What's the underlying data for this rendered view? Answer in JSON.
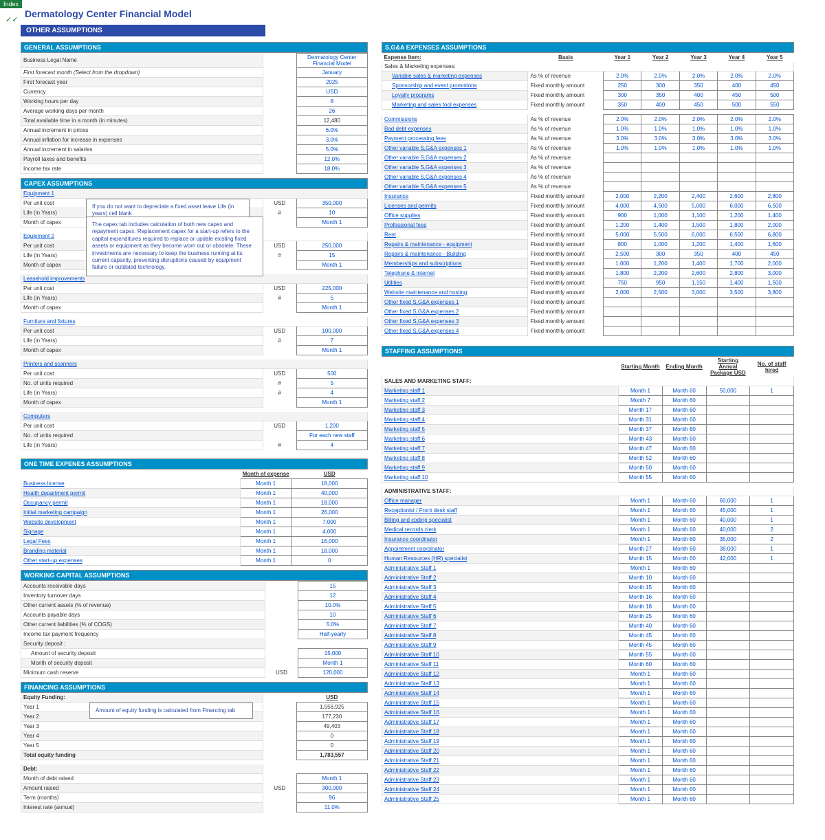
{
  "indexTag": "Index",
  "title": "Dermatology Center Financial Model",
  "sectionBar": "OTHER ASSUMPTIONS",
  "general": {
    "head": "GENERAL ASSUMPTIONS",
    "rows": [
      {
        "l": "Business Legal Name",
        "v": "Dermatology Center Financial Model"
      },
      {
        "l": "First forecast month (Select from the dropdown)",
        "v": "January",
        "i": 1
      },
      {
        "l": "First forecast year",
        "v": "2025"
      },
      {
        "l": "Currency",
        "v": "USD"
      },
      {
        "l": "Working hours per day",
        "v": "8"
      },
      {
        "l": "Average working days per month",
        "v": "26"
      },
      {
        "l": "Total available time in a month (in minutes)",
        "v": "12,480",
        "calc": 1
      },
      {
        "l": "Annual increment in prices",
        "v": "6.0%"
      },
      {
        "l": "Annual inflation for increase in expenses",
        "v": "3.0%"
      },
      {
        "l": "Annual increment in salaries",
        "v": "5.0%"
      },
      {
        "l": "Payroll taxes and benefits",
        "v": "12.0%"
      },
      {
        "l": "Income tax rate",
        "v": "18.0%"
      }
    ]
  },
  "capex": {
    "head": "CAPEX ASSUMPTIONS",
    "note1": "If you do not want to depreciate a fixed asset leave Life (in years) cell blank",
    "note2": "The capex tab includes calculation of both new capex and repayment capex. Replacement capex for a start-up refers to the capital expenditures required to replace or update existing fixed assets or equipment as they become worn out or obsolete. These investments are necessary to keep the business running at its current capacity, preventing disruptions caused by equipment failure or outdated technology.",
    "groups": [
      {
        "name": "Equipment 1",
        "rows": [
          [
            "Per unit cost",
            "USD",
            "350,000"
          ],
          [
            "Life (in Years)",
            "#",
            "10"
          ],
          [
            "Month of capex",
            "",
            "Month 1"
          ]
        ]
      },
      {
        "name": "Equipment 2",
        "rows": [
          [
            "Per unit cost",
            "USD",
            "250,000"
          ],
          [
            "Life (in Years)",
            "#",
            "15"
          ],
          [
            "Month of capex",
            "",
            "Month 1"
          ]
        ]
      },
      {
        "name": "Leasehold improvements",
        "rows": [
          [
            "Per unit cost",
            "USD",
            "225,000"
          ],
          [
            "Life (in Years)",
            "#",
            "5"
          ],
          [
            "Month of capex",
            "",
            "Month 1"
          ]
        ]
      },
      {
        "name": "Furniture and fixtures",
        "rows": [
          [
            "Per unit cost",
            "USD",
            "100,000"
          ],
          [
            "Life (in Years)",
            "#",
            "7"
          ],
          [
            "Month of capex",
            "",
            "Month 1"
          ]
        ]
      },
      {
        "name": "Printers and scanners",
        "rows": [
          [
            "Per unit cost",
            "USD",
            "500"
          ],
          [
            "No. of units required",
            "#",
            "5"
          ],
          [
            "Life (in Years)",
            "#",
            "4"
          ],
          [
            "Month of capex",
            "",
            "Month 1"
          ]
        ]
      },
      {
        "name": "Computers",
        "rows": [
          [
            "Per unit cost",
            "USD",
            "1,200"
          ],
          [
            "No. of units required",
            "",
            "For each new staff"
          ],
          [
            "Life (in Years)",
            "#",
            "4"
          ]
        ]
      }
    ]
  },
  "onetime": {
    "head": "ONE TIME EXPENES ASSUMPTIONS",
    "h1": "Month of expense",
    "h2": "USD",
    "rows": [
      [
        "Business license",
        "Month 1",
        "18,000"
      ],
      [
        "Health department permit",
        "Month 1",
        "40,000"
      ],
      [
        "Occupancy permit",
        "Month 1",
        "18,000"
      ],
      [
        "Initial marketing campaign",
        "Month 1",
        "26,000"
      ],
      [
        "Website development",
        "Month 1",
        "7,000"
      ],
      [
        "Signage",
        "Month 1",
        "4,000"
      ],
      [
        "Legal Fees",
        "Month 1",
        "16,000"
      ],
      [
        "Branding material",
        "Month 1",
        "18,000"
      ],
      [
        "Other start-up expenses",
        "Month 1",
        "0"
      ]
    ]
  },
  "wcap": {
    "head": "WORKING CAPITAL ASSUMPTIONS",
    "rows": [
      [
        "Accounts receivable days",
        "",
        "15"
      ],
      [
        "Inventory turnover days",
        "",
        "12"
      ],
      [
        "Other current assets (% of revenue)",
        "",
        "10.0%"
      ],
      [
        "Accounts payable days",
        "",
        "10"
      ],
      [
        "Other current liabilities (% of COGS)",
        "",
        "5.0%"
      ],
      [
        "Income tax payment frequency",
        "",
        "Half-yearly"
      ],
      [
        "Security deposit :",
        "",
        ""
      ],
      [
        "    Amount of security deposit",
        "",
        "15,000",
        "indent"
      ],
      [
        "    Month of security deposit",
        "",
        "Month 1",
        "indent"
      ],
      [
        "Minimum cash reserve",
        "USD",
        "120,000"
      ]
    ]
  },
  "fin": {
    "head": "FINANCING ASSUMPTIONS",
    "note": "Amount of equity funding is calculated from Financing tab",
    "eqHead": "Equity Funding:",
    "usd": "USD",
    "eq": [
      [
        "Year 1",
        "1,556,925"
      ],
      [
        "Year 2",
        "177,230"
      ],
      [
        "Year 3",
        "49,403"
      ],
      [
        "Year 4",
        "0"
      ],
      [
        "Year 5",
        "0"
      ]
    ],
    "eqTotL": "Total equity funding",
    "eqTot": "1,783,557",
    "debtHead": "Debt:",
    "debt": [
      [
        "Month of debt raised",
        "",
        "Month 1"
      ],
      [
        "Amount raised",
        "USD",
        "300,000"
      ],
      [
        "Term (months)",
        "",
        "96"
      ],
      [
        "Interest rate (annual)",
        "",
        "11.0%"
      ]
    ]
  },
  "sga": {
    "head": "S,G&A EXPENSES ASSUMPTIONS",
    "cols": [
      "Expense Item:",
      "Basis",
      "Year 1",
      "Year 2",
      "Year 3",
      "Year 4",
      "Year 5"
    ],
    "sub1": "Sales & Marketing expenses:",
    "smk": [
      [
        "Variable sales & marketing expenses",
        "As % of revenue",
        "2.0%",
        "2.0%",
        "2.0%",
        "2.0%",
        "2.0%"
      ],
      [
        "Sponsorship and event promotions",
        "Fixed monthly amount",
        "250",
        "300",
        "350",
        "400",
        "450"
      ],
      [
        "Loyalty programs",
        "Fixed monthly amount",
        "300",
        "350",
        "400",
        "450",
        "500"
      ],
      [
        "Marketing and sales tool expenses",
        "Fixed monthly amount",
        "350",
        "400",
        "450",
        "500",
        "550"
      ]
    ],
    "rest": [
      [
        "Commissions",
        "As % of revenue",
        "2.0%",
        "2.0%",
        "2.0%",
        "2.0%",
        "2.0%"
      ],
      [
        "Bad debt expenses",
        "As % of revenue",
        "1.0%",
        "1.0%",
        "1.0%",
        "1.0%",
        "1.0%"
      ],
      [
        "Payment processing fees",
        "As % of revenue",
        "3.0%",
        "3.0%",
        "3.0%",
        "3.0%",
        "3.0%"
      ],
      [
        "Other variable S,G&A expenses 1",
        "As % of revenue",
        "1.0%",
        "1.0%",
        "1.0%",
        "1.0%",
        "1.0%"
      ],
      [
        "Other variable S,G&A expenses 2",
        "As % of revenue",
        "",
        "",
        "",
        "",
        ""
      ],
      [
        "Other variable S,G&A expenses 3",
        "As % of revenue",
        "",
        "",
        "",
        "",
        ""
      ],
      [
        "Other variable S,G&A expenses 4",
        "As % of revenue",
        "",
        "",
        "",
        "",
        ""
      ],
      [
        "Other variable S,G&A expenses 5",
        "As % of revenue",
        "",
        "",
        "",
        "",
        ""
      ],
      [
        "Insurance",
        "Fixed monthly amount",
        "2,000",
        "2,200",
        "2,400",
        "2,600",
        "2,800"
      ],
      [
        "Licenses and permits",
        "Fixed monthly amount",
        "4,000",
        "4,500",
        "5,000",
        "6,000",
        "6,500"
      ],
      [
        "Office supplies",
        "Fixed monthly amount",
        "900",
        "1,000",
        "1,100",
        "1,200",
        "1,400"
      ],
      [
        "Professional fees",
        "Fixed monthly amount",
        "1,200",
        "1,400",
        "1,500",
        "1,800",
        "2,000"
      ],
      [
        "Rent",
        "Fixed monthly amount",
        "5,000",
        "5,500",
        "6,000",
        "6,500",
        "6,800"
      ],
      [
        "Repairs & maintenance - equipment",
        "Fixed monthly amount",
        "800",
        "1,000",
        "1,200",
        "1,400",
        "1,600"
      ],
      [
        "Repairs & maintenance - Building",
        "Fixed monthly amount",
        "2,500",
        "300",
        "350",
        "400",
        "450"
      ],
      [
        "Memberships and subscriptions",
        "Fixed monthly amount",
        "1,000",
        "1,200",
        "1,400",
        "1,700",
        "2,000"
      ],
      [
        "Telephone & internet",
        "Fixed monthly amount",
        "1,800",
        "2,200",
        "2,600",
        "2,800",
        "3,000"
      ],
      [
        "Utilities",
        "Fixed monthly amount",
        "750",
        "950",
        "1,150",
        "1,400",
        "1,500"
      ],
      [
        "Website maintenance and hosting",
        "Fixed monthly amount",
        "2,000",
        "2,500",
        "3,000",
        "3,500",
        "3,800"
      ],
      [
        "Other fixed S,G&A expenses 1",
        "Fixed monthly amount",
        "",
        "",
        "",
        "",
        ""
      ],
      [
        "Other fixed S,G&A expenses 2",
        "Fixed monthly amount",
        "",
        "",
        "",
        "",
        ""
      ],
      [
        "Other fixed S,G&A expenses 3",
        "Fixed monthly amount",
        "",
        "",
        "",
        "",
        ""
      ],
      [
        "Other fixed S,G&A expenses 4",
        "Fixed monthly amount",
        "",
        "",
        "",
        "",
        ""
      ]
    ]
  },
  "staff": {
    "head": "STAFFING ASSUMPTIONS",
    "cols": [
      "Starting Month",
      "Ending Month",
      "Starting Annual Package USD",
      "No. of staff hired"
    ],
    "g1": {
      "name": "SALES AND MARKETING STAFF:",
      "rows": [
        [
          "Marketing staff 1",
          "Month 1",
          "Month 60",
          "50,000",
          "1"
        ],
        [
          "Marketing staff 2",
          "Month 7",
          "Month 60",
          "",
          ""
        ],
        [
          "Marketing staff 3",
          "Month 17",
          "Month 60",
          "",
          ""
        ],
        [
          "Marketing staff 4",
          "Month 31",
          "Month 60",
          "",
          ""
        ],
        [
          "Marketing staff 5",
          "Month 37",
          "Month 60",
          "",
          ""
        ],
        [
          "Marketing staff 6",
          "Month 43",
          "Month 60",
          "",
          ""
        ],
        [
          "Marketing staff 7",
          "Month 47",
          "Month 60",
          "",
          ""
        ],
        [
          "Marketing staff 8",
          "Month 52",
          "Month 60",
          "",
          ""
        ],
        [
          "Marketing staff 9",
          "Month 50",
          "Month 60",
          "",
          ""
        ],
        [
          "Marketing staff 10",
          "Month 55",
          "Month 60",
          "",
          ""
        ]
      ]
    },
    "g2": {
      "name": "ADMINISTRATIVE STAFF:",
      "rows": [
        [
          "Office manager",
          "Month 1",
          "Month 60",
          "60,000",
          "1"
        ],
        [
          "Receptionist / Front desk staff",
          "Month 1",
          "Month 60",
          "45,000",
          "1"
        ],
        [
          "Billing and coding specialist",
          "Month 1",
          "Month 60",
          "40,000",
          "1"
        ],
        [
          "Medical records clerk",
          "Month 1",
          "Month 60",
          "40,000",
          "2"
        ],
        [
          "Insurance coordinator",
          "Month 1",
          "Month 60",
          "35,000",
          "2"
        ],
        [
          "Appointment coordinator",
          "Month 27",
          "Month 60",
          "38,000",
          "1"
        ],
        [
          "Human Resources (HR) specialist",
          "Month 15",
          "Month 60",
          "42,000",
          "1"
        ],
        [
          "Administrative Staff 1",
          "Month 1",
          "Month 60",
          "",
          ""
        ],
        [
          "Administrative Staff 2",
          "Month 10",
          "Month 60",
          "",
          ""
        ],
        [
          "Administrative Staff 3",
          "Month 15",
          "Month 60",
          "",
          ""
        ],
        [
          "Administrative Staff 4",
          "Month 16",
          "Month 60",
          "",
          ""
        ],
        [
          "Administrative Staff 5",
          "Month 18",
          "Month 60",
          "",
          ""
        ],
        [
          "Administrative Staff 6",
          "Month 25",
          "Month 60",
          "",
          ""
        ],
        [
          "Administrative Staff 7",
          "Month 40",
          "Month 60",
          "",
          ""
        ],
        [
          "Administrative Staff 8",
          "Month 45",
          "Month 60",
          "",
          ""
        ],
        [
          "Administrative Staff 9",
          "Month 45",
          "Month 60",
          "",
          ""
        ],
        [
          "Administrative Staff 10",
          "Month 55",
          "Month 60",
          "",
          ""
        ],
        [
          "Administrative Staff 11",
          "Month 60",
          "Month 60",
          "",
          ""
        ],
        [
          "Administrative Staff 12",
          "Month 1",
          "Month 60",
          "",
          ""
        ],
        [
          "Administrative Staff 13",
          "Month 1",
          "Month 60",
          "",
          ""
        ],
        [
          "Administrative Staff 14",
          "Month 1",
          "Month 60",
          "",
          ""
        ],
        [
          "Administrative Staff 15",
          "Month 1",
          "Month 60",
          "",
          ""
        ],
        [
          "Administrative Staff 16",
          "Month 1",
          "Month 60",
          "",
          ""
        ],
        [
          "Administrative Staff 17",
          "Month 1",
          "Month 60",
          "",
          ""
        ],
        [
          "Administrative Staff 18",
          "Month 1",
          "Month 60",
          "",
          ""
        ],
        [
          "Administrative Staff 19",
          "Month 1",
          "Month 60",
          "",
          ""
        ],
        [
          "Administrative Staff 20",
          "Month 1",
          "Month 60",
          "",
          ""
        ],
        [
          "Administrative Staff 21",
          "Month 1",
          "Month 60",
          "",
          ""
        ],
        [
          "Administrative Staff 22",
          "Month 1",
          "Month 60",
          "",
          ""
        ],
        [
          "Administrative Staff 23",
          "Month 1",
          "Month 60",
          "",
          ""
        ],
        [
          "Administrative Staff 24",
          "Month 1",
          "Month 60",
          "",
          ""
        ],
        [
          "Administrative Staff 25",
          "Month 1",
          "Month 60",
          "",
          ""
        ]
      ]
    }
  }
}
